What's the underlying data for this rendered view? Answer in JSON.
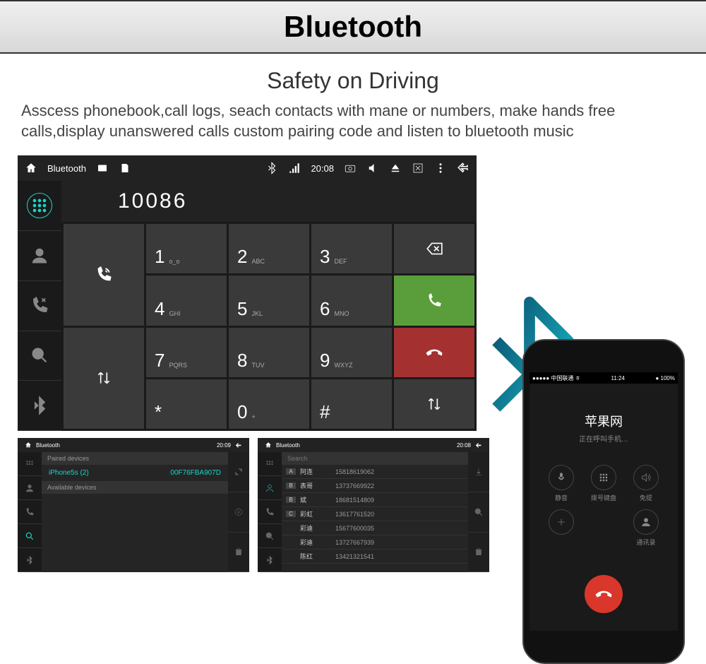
{
  "title": "Bluetooth",
  "subtitle": "Safety on Driving",
  "description": "Asscess phonebook,call logs, seach contacts with mane or numbers, make hands free calls,display unanswered calls custom pairing code and listen to bluetooth music",
  "main": {
    "status": {
      "title": "Bluetooth",
      "time": "20:08"
    },
    "dialed_number": "10086",
    "keys": [
      {
        "d": "1",
        "l": "o_o"
      },
      {
        "d": "2",
        "l": "ABC"
      },
      {
        "d": "3",
        "l": "DEF"
      },
      {
        "d": "4",
        "l": "GHI"
      },
      {
        "d": "5",
        "l": "JKL"
      },
      {
        "d": "6",
        "l": "MNO"
      },
      {
        "d": "7",
        "l": "PQRS"
      },
      {
        "d": "8",
        "l": "TUV"
      },
      {
        "d": "9",
        "l": "WXYZ"
      },
      {
        "d": "*",
        "l": ""
      },
      {
        "d": "0",
        "l": "+"
      },
      {
        "d": "#",
        "l": ""
      }
    ]
  },
  "phone": {
    "carrier": "●●●●● 中国联通 ㅎ",
    "time": "11:24",
    "battery": "● 100%",
    "caller": "苹果网",
    "call_status": "正在呼叫手机…",
    "controls": [
      "静音",
      "拨号键盘",
      "免提",
      "",
      "",
      "通讯录"
    ]
  },
  "mini1": {
    "title": "Bluetooth",
    "time": "20:09",
    "section1": "Paired devices",
    "device_name": "iPhone5s (2)",
    "device_id": "00F76FBA907D",
    "section2": "Available devices"
  },
  "mini2": {
    "title": "Bluetooth",
    "time": "20:08",
    "search": "Search",
    "contacts": [
      {
        "letter": "A",
        "name": "阿连",
        "phone": "15818619062"
      },
      {
        "letter": "B",
        "name": "表哥",
        "phone": "13737669922"
      },
      {
        "letter": "B",
        "name": "斌",
        "phone": "18681514809"
      },
      {
        "letter": "C",
        "name": "彩虹",
        "phone": "13617761520"
      },
      {
        "letter": "",
        "name": "彩迪",
        "phone": "15677600035"
      },
      {
        "letter": "",
        "name": "彩迪",
        "phone": "13727667939"
      },
      {
        "letter": "",
        "name": "陈红",
        "phone": "13421321541"
      }
    ]
  }
}
